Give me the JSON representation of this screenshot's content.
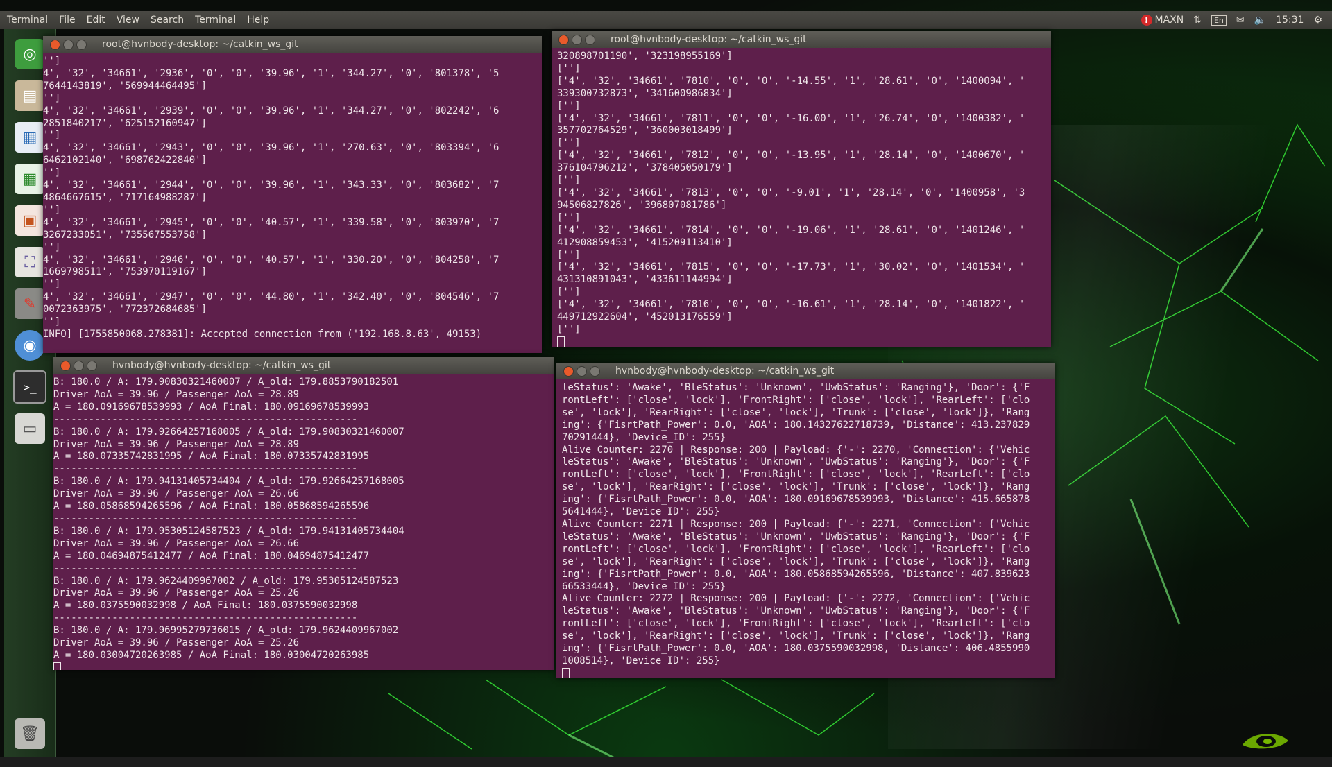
{
  "panel": {
    "menu": [
      "Terminal",
      "File",
      "Edit",
      "View",
      "Search",
      "Terminal",
      "Help"
    ],
    "maxn_label": "MAXN",
    "lang": "En",
    "clock": "15:31"
  },
  "colors": {
    "terminal_bg": "#5e1f4b",
    "accent_green": "#3aff3a"
  },
  "launcher": {
    "icons": [
      "dash-home-icon",
      "files-icon",
      "writer-icon",
      "calc-icon",
      "impress-icon",
      "store-icon",
      "settings-icon",
      "chromium-icon",
      "terminal-icon",
      "drive-icon",
      "trash-icon"
    ]
  },
  "windows": {
    "top_left": {
      "title": "root@hvnbody-desktop: ~/catkin_ws_git",
      "lines": [
        "'']",
        "4', '32', '34661', '2936', '0', '0', '39.96', '1', '344.27', '0', '801378', '5",
        "7644143819', '569944464495']",
        "'']",
        "4', '32', '34661', '2939', '0', '0', '39.96', '1', '344.27', '0', '802242', '6",
        "2851840217', '625152160947']",
        "'']",
        "4', '32', '34661', '2943', '0', '0', '39.96', '1', '270.63', '0', '803394', '6",
        "6462102140', '698762422840']",
        "'']",
        "4', '32', '34661', '2944', '0', '0', '39.96', '1', '343.33', '0', '803682', '7",
        "4864667615', '717164988287']",
        "'']",
        "4', '32', '34661', '2945', '0', '0', '40.57', '1', '339.58', '0', '803970', '7",
        "3267233051', '735567553758']",
        "'']",
        "4', '32', '34661', '2946', '0', '0', '40.57', '1', '330.20', '0', '804258', '7",
        "1669798511', '753970119167']",
        "'']",
        "4', '32', '34661', '2947', '0', '0', '44.80', '1', '342.40', '0', '804546', '7",
        "0072363975', '772372684685']",
        "'']",
        "INFO] [1755850068.278381]: Accepted connection from ('192.168.8.63', 49153)"
      ]
    },
    "top_right": {
      "title": "root@hvnbody-desktop: ~/catkin_ws_git",
      "lines": [
        "320898701190', '323198955169']",
        "['']",
        "['4', '32', '34661', '7810', '0', '0', '-14.55', '1', '28.61', '0', '1400094', '",
        "339300732873', '341600986834']",
        "['']",
        "['4', '32', '34661', '7811', '0', '0', '-16.00', '1', '26.74', '0', '1400382', '",
        "357702764529', '360003018499']",
        "['']",
        "['4', '32', '34661', '7812', '0', '0', '-13.95', '1', '28.14', '0', '1400670', '",
        "376104796212', '378405050179']",
        "['']",
        "['4', '32', '34661', '7813', '0', '0', '-9.01', '1', '28.14', '0', '1400958', '3",
        "94506827826', '396807081786']",
        "['']",
        "['4', '32', '34661', '7814', '0', '0', '-19.06', '1', '28.61', '0', '1401246', '",
        "412908859453', '415209113410']",
        "['']",
        "['4', '32', '34661', '7815', '0', '0', '-17.73', '1', '30.02', '0', '1401534', '",
        "431310891043', '433611144994']",
        "['']",
        "['4', '32', '34661', '7816', '0', '0', '-16.61', '1', '28.14', '0', '1401822', '",
        "449712922604', '452013176559']",
        "['']"
      ]
    },
    "bottom_left": {
      "title": "hvnbody@hvnbody-desktop: ~/catkin_ws_git",
      "lines": [
        "B: 180.0 / A: 179.90830321460007 / A_old: 179.8853790182501",
        "Driver AoA = 39.96 / Passenger AoA = 28.89",
        "A = 180.09169678539993 / AoA Final: 180.09169678539993",
        "----------------------------------------------------",
        "B: 180.0 / A: 179.92664257168005 / A_old: 179.90830321460007",
        "Driver AoA = 39.96 / Passenger AoA = 28.89",
        "A = 180.07335742831995 / AoA Final: 180.07335742831995",
        "----------------------------------------------------",
        "B: 180.0 / A: 179.94131405734404 / A_old: 179.92664257168005",
        "Driver AoA = 39.96 / Passenger AoA = 26.66",
        "A = 180.05868594265596 / AoA Final: 180.05868594265596",
        "----------------------------------------------------",
        "B: 180.0 / A: 179.95305124587523 / A_old: 179.94131405734404",
        "Driver AoA = 39.96 / Passenger AoA = 26.66",
        "A = 180.04694875412477 / AoA Final: 180.04694875412477",
        "----------------------------------------------------",
        "B: 180.0 / A: 179.9624409967002 / A_old: 179.95305124587523",
        "Driver AoA = 39.96 / Passenger AoA = 25.26",
        "A = 180.0375590032998 / AoA Final: 180.0375590032998",
        "----------------------------------------------------",
        "B: 180.0 / A: 179.96995279736015 / A_old: 179.9624409967002",
        "Driver AoA = 39.96 / Passenger AoA = 25.26",
        "A = 180.03004720263985 / AoA Final: 180.03004720263985"
      ]
    },
    "bottom_right": {
      "title": "hvnbody@hvnbody-desktop: ~/catkin_ws_git",
      "lines": [
        "leStatus': 'Awake', 'BleStatus': 'Unknown', 'UwbStatus': 'Ranging'}, 'Door': {'F",
        "rontLeft': ['close', 'lock'], 'FrontRight': ['close', 'lock'], 'RearLeft': ['clo",
        "se', 'lock'], 'RearRight': ['close', 'lock'], 'Trunk': ['close', 'lock']}, 'Rang",
        "ing': {'FisrtPath_Power': 0.0, 'AOA': 180.14327622718739, 'Distance': 413.237829",
        "70291444}, 'Device_ID': 255}",
        "Alive Counter: 2270 | Response: 200 | Payload: {'-': 2270, 'Connection': {'Vehic",
        "leStatus': 'Awake', 'BleStatus': 'Unknown', 'UwbStatus': 'Ranging'}, 'Door': {'F",
        "rontLeft': ['close', 'lock'], 'FrontRight': ['close', 'lock'], 'RearLeft': ['clo",
        "se', 'lock'], 'RearRight': ['close', 'lock'], 'Trunk': ['close', 'lock']}, 'Rang",
        "ing': {'FisrtPath_Power': 0.0, 'AOA': 180.09169678539993, 'Distance': 415.665878",
        "5641444}, 'Device_ID': 255}",
        "Alive Counter: 2271 | Response: 200 | Payload: {'-': 2271, 'Connection': {'Vehic",
        "leStatus': 'Awake', 'BleStatus': 'Unknown', 'UwbStatus': 'Ranging'}, 'Door': {'F",
        "rontLeft': ['close', 'lock'], 'FrontRight': ['close', 'lock'], 'RearLeft': ['clo",
        "se', 'lock'], 'RearRight': ['close', 'lock'], 'Trunk': ['close', 'lock']}, 'Rang",
        "ing': {'FisrtPath_Power': 0.0, 'AOA': 180.05868594265596, 'Distance': 407.839623",
        "66533444}, 'Device_ID': 255}",
        "Alive Counter: 2272 | Response: 200 | Payload: {'-': 2272, 'Connection': {'Vehic",
        "leStatus': 'Awake', 'BleStatus': 'Unknown', 'UwbStatus': 'Ranging'}, 'Door': {'F",
        "rontLeft': ['close', 'lock'], 'FrontRight': ['close', 'lock'], 'RearLeft': ['clo",
        "se', 'lock'], 'RearRight': ['close', 'lock'], 'Trunk': ['close', 'lock']}, 'Rang",
        "ing': {'FisrtPath_Power': 0.0, 'AOA': 180.0375590032998, 'Distance': 406.4855990",
        "1008514}, 'Device_ID': 255}"
      ]
    }
  }
}
